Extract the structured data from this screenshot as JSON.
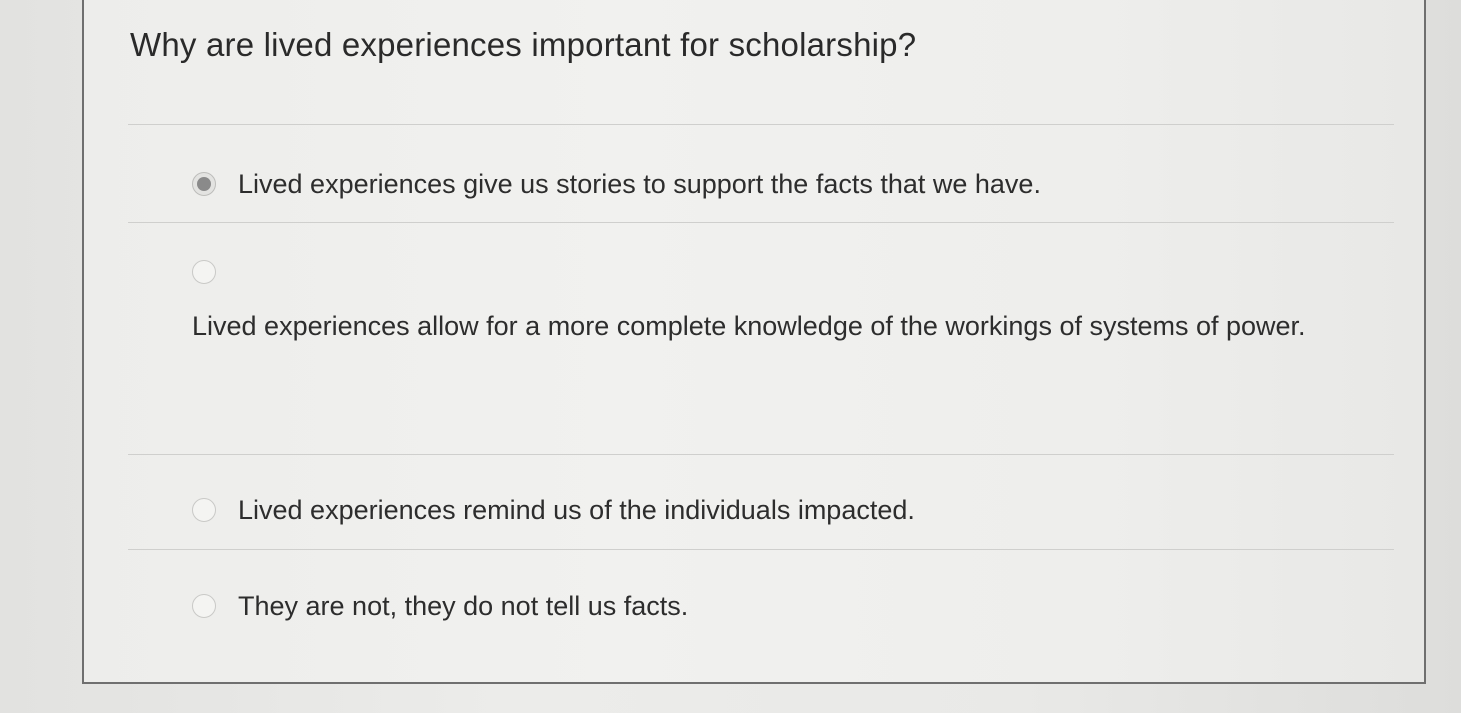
{
  "quiz": {
    "question": "Why are lived experiences important for scholarship?",
    "options": [
      {
        "label": "Lived experiences give us stories to support the facts that we have.",
        "selected": true
      },
      {
        "label": "Lived experiences allow for a more complete knowledge of the workings of systems of power.",
        "selected": false
      },
      {
        "label": "Lived experiences remind us of the individuals impacted.",
        "selected": false
      },
      {
        "label": "They are not, they do not tell us facts.",
        "selected": false
      }
    ]
  }
}
